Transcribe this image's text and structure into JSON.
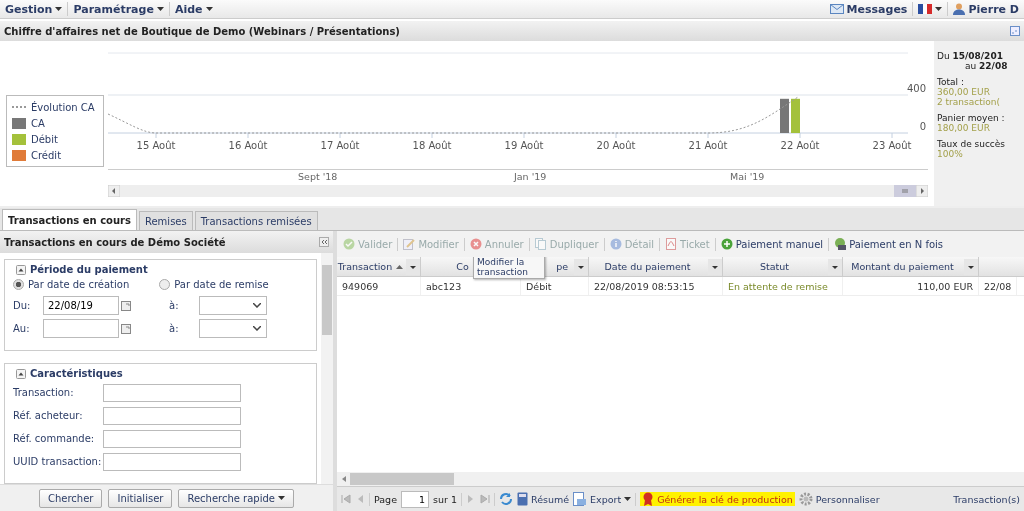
{
  "menu": {
    "left": [
      {
        "label": "Gestion"
      },
      {
        "label": "Paramétrage"
      },
      {
        "label": "Aide"
      }
    ],
    "messages": "Messages",
    "user": "Pierre D"
  },
  "chart_panel": {
    "title": "Chiffre d'affaires net de Boutique de Demo (Webinars / Présentations)",
    "chart_data": {
      "type": "bar",
      "categories": [
        "15 Août",
        "16 Août",
        "17 Août",
        "18 Août",
        "19 Août",
        "20 Août",
        "21 Août",
        "22 Août",
        "23 Août"
      ],
      "series": [
        {
          "name": "CA",
          "color": "#777777",
          "values": [
            0,
            0,
            0,
            0,
            0,
            0,
            0,
            360,
            0
          ]
        },
        {
          "name": "Débit",
          "color": "#a4c13b",
          "values": [
            0,
            0,
            0,
            0,
            0,
            0,
            0,
            360,
            0
          ]
        },
        {
          "name": "Crédit",
          "color": "#e07b39",
          "values": [
            0,
            0,
            0,
            0,
            0,
            0,
            0,
            0,
            0
          ]
        }
      ],
      "ylim": [
        0,
        400
      ],
      "yticks": [
        0,
        400
      ]
    },
    "trend": {
      "label": "Évolution CA",
      "color": "#999999"
    },
    "navigator": [
      "Sept '18",
      "Jan '19",
      "Mai '19"
    ],
    "summary": {
      "period_from": "Du **15/08/201**",
      "period_to": "au **22/08**",
      "total_label": "Total :",
      "total": "360,00 EUR",
      "count": "2 transaction(",
      "average_label": "Panier moyen :",
      "average": "180,00 EUR",
      "success_label": "Taux de succès",
      "success": "100%"
    }
  },
  "tabs": [
    {
      "label": "Transactions en cours",
      "selected": true
    },
    {
      "label": "Remises",
      "selected": false
    },
    {
      "label": "Transactions remisées",
      "selected": false
    }
  ],
  "search_panel": {
    "title": "Transactions en cours de Démo Société",
    "period": {
      "legend": "Période du paiement",
      "radios": [
        {
          "label": "Par date de création",
          "selected": true
        },
        {
          "label": "Par date de remise",
          "selected": false
        }
      ],
      "rows": [
        {
          "label": "Du:",
          "value": "22/08/19",
          "time_label": "à:"
        },
        {
          "label": "Au:",
          "value": "",
          "time_label": "à:"
        }
      ]
    },
    "characteristics": {
      "legend": "Caractéristiques",
      "fields": [
        "Transaction:",
        "Réf. acheteur:",
        "Réf. commande:",
        "UUID transaction:"
      ]
    },
    "buttons": [
      "Chercher",
      "Initialiser",
      "Recherche rapide"
    ]
  },
  "toolbar": [
    {
      "label": "Valider",
      "disabled": true
    },
    {
      "label": "Modifier",
      "disabled": true
    },
    {
      "label": "Annuler",
      "disabled": true
    },
    {
      "label": "Dupliquer",
      "disabled": true
    },
    {
      "label": "Détail",
      "disabled": true
    },
    {
      "label": "Ticket",
      "disabled": true
    },
    {
      "label": "Paiement manuel",
      "disabled": false
    },
    {
      "label": "Paiement en N fois",
      "disabled": false
    }
  ],
  "tooltip": "Modifier la transaction",
  "table": {
    "columns": [
      {
        "label": "Transaction",
        "sorted": true
      },
      {
        "label": "Co",
        "sorted": false
      },
      {
        "label": "pe",
        "sorted": false
      },
      {
        "label": "Date du paiement",
        "sorted": false
      },
      {
        "label": "Statut",
        "sorted": false
      },
      {
        "label": "Montant du paiement",
        "sorted": false
      }
    ],
    "rows": [
      {
        "cells": [
          "949069",
          "abc123",
          "Débit",
          "22/08/2019 08:53:15",
          "En attente de remise",
          "110,00 EUR"
        ],
        "extra": "22/08"
      }
    ]
  },
  "pager": {
    "page_label": "Page",
    "page": "1",
    "of": "sur 1",
    "summary": "Résumé",
    "export": "Export",
    "production_key": "Générer la clé de production",
    "customize": "Personnaliser",
    "count_label": "Transaction(s)"
  }
}
